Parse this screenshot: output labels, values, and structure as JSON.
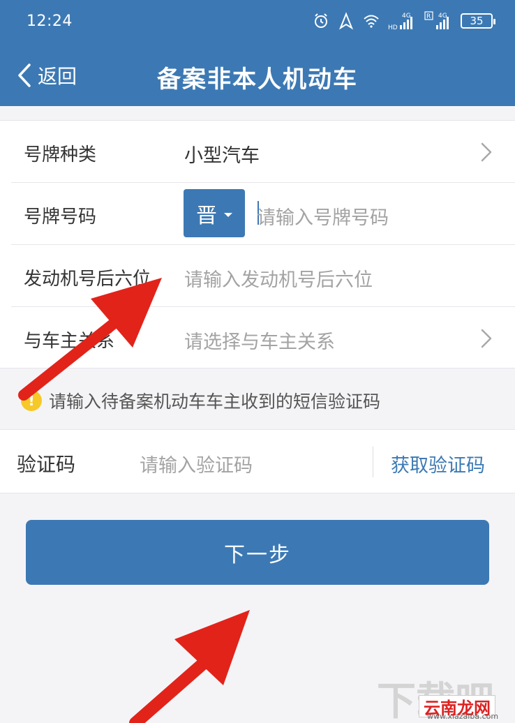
{
  "status_bar": {
    "time": "12:24",
    "battery": "35",
    "network_1": "4G",
    "network_2": "4G",
    "hd": "HD",
    "roaming": "R"
  },
  "nav": {
    "back_label": "返回",
    "title": "备案非本人机动车"
  },
  "form": {
    "plate_type": {
      "label": "号牌种类",
      "value": "小型汽车"
    },
    "plate_number": {
      "label": "号牌号码",
      "province": "晋",
      "placeholder": "请输入号牌号码"
    },
    "engine": {
      "label": "发动机号后六位",
      "placeholder": "请输入发动机号后六位"
    },
    "relation": {
      "label": "与车主关系",
      "placeholder": "请选择与车主关系"
    }
  },
  "notice": {
    "icon": "warning-icon",
    "text": "请输入待备案机动车车主收到的短信验证码"
  },
  "verification": {
    "label": "验证码",
    "placeholder": "请输入验证码",
    "get_code": "获取验证码"
  },
  "next_button": "下一步",
  "watermark": {
    "site1": "下载吧",
    "site2": "云南龙网",
    "site3": "www.xiazaiba.com"
  },
  "colors": {
    "primary": "#3c79b4",
    "warning": "#f6c928",
    "annotation_arrow": "#e2231a"
  }
}
